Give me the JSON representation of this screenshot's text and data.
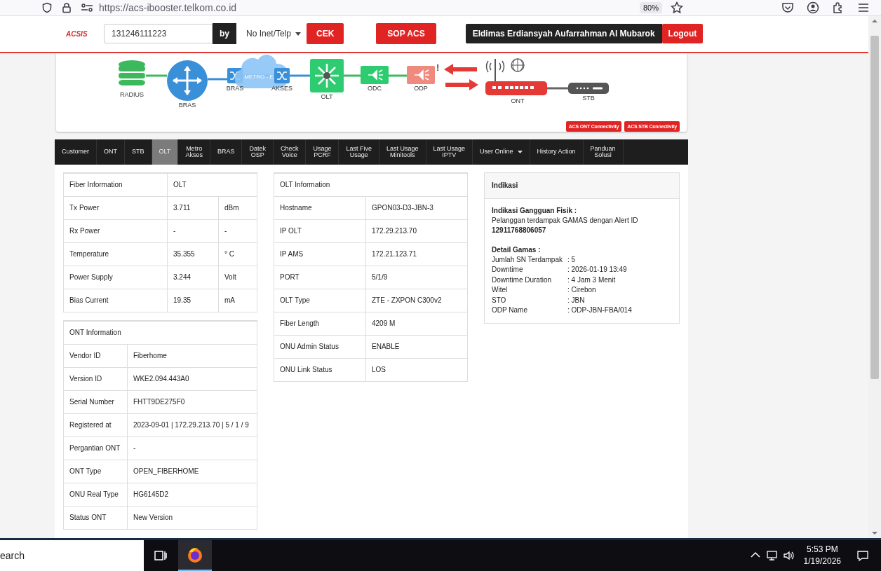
{
  "browser": {
    "url": "https://acs-ibooster.telkom.co.id",
    "zoom": "80%"
  },
  "header": {
    "logo": "ACSIS",
    "search_value": "131246111223",
    "by": "by",
    "select": "No Inet/Telp",
    "cek": "CEK",
    "sop": "SOP ACS",
    "user": "Eldimas Erdiansyah Aufarrahman Al Mubarok",
    "logout": "Logout"
  },
  "diagram": {
    "cloud_label": "METRO - E",
    "alert_mark": "!",
    "nodes": [
      {
        "kind": "radius",
        "label": "RADIUS",
        "alert": false
      },
      {
        "kind": "router",
        "label": "BRAS",
        "alert": false
      },
      {
        "kind": "switch",
        "label": "BRAS",
        "alert": false
      },
      {
        "kind": "switch2",
        "label": "AKSES",
        "alert": false
      },
      {
        "kind": "olt",
        "label": "OLT",
        "alert": false
      },
      {
        "kind": "splitter",
        "label": "ODC",
        "alert": false
      },
      {
        "kind": "splitter2",
        "label": "ODP",
        "alert": true
      },
      {
        "kind": "ont",
        "label": "ONT",
        "alert": false
      },
      {
        "kind": "stb",
        "label": "STB",
        "alert": false
      }
    ],
    "buttons": [
      "ACS ONT Connectivity",
      "ACS STB Connectivity"
    ]
  },
  "tabs": [
    {
      "label": "Customer",
      "selected": false,
      "menu": false
    },
    {
      "label": "ONT",
      "selected": false,
      "menu": false
    },
    {
      "label": "STB",
      "selected": false,
      "menu": false
    },
    {
      "label": "OLT",
      "selected": true,
      "menu": false
    },
    {
      "label": "Metro\nAkses",
      "selected": false,
      "menu": false
    },
    {
      "label": "BRAS",
      "selected": false,
      "menu": false
    },
    {
      "label": "Datek\nOSP",
      "selected": false,
      "menu": false
    },
    {
      "label": "Check\nVoice",
      "selected": false,
      "menu": false
    },
    {
      "label": "Usage\nPCRF",
      "selected": false,
      "menu": false
    },
    {
      "label": "Last Five\nUsage",
      "selected": false,
      "menu": false
    },
    {
      "label": "Last Usage\nMinitools",
      "selected": false,
      "menu": false
    },
    {
      "label": "Last Usage\nIPTV",
      "selected": false,
      "menu": false
    },
    {
      "label": "User Online",
      "selected": false,
      "menu": true
    },
    {
      "label": "History Action",
      "selected": false,
      "menu": false
    },
    {
      "label": "Panduan\nSolusi",
      "selected": false,
      "menu": false
    }
  ],
  "fiber_information": {
    "columns": [
      "Fiber Information",
      "OLT"
    ],
    "rows": [
      [
        "Tx Power",
        "3.711",
        "dBm"
      ],
      [
        "Rx Power",
        "-",
        "-"
      ],
      [
        "Temperature",
        "35.355",
        "° C"
      ],
      [
        "Power Supply",
        "3.244",
        "Volt"
      ],
      [
        "Bias Current",
        "19.35",
        "mA"
      ]
    ]
  },
  "ont_information": {
    "title": "ONT Information",
    "rows": [
      [
        "Vendor ID",
        "Fiberhome"
      ],
      [
        "Version ID",
        "WKE2.094.443A0"
      ],
      [
        "Serial Number",
        "FHTT9DE275F0"
      ],
      [
        "Registered at",
        "2023-09-01 | 172.29.213.70 | 5 / 1 / 9"
      ],
      [
        "Pergantian ONT",
        "-"
      ],
      [
        "ONT Type",
        "OPEN_FIBERHOME"
      ],
      [
        "ONU Real Type",
        "HG6145D2"
      ],
      [
        "Status ONT",
        "New Version"
      ]
    ]
  },
  "olt_information": {
    "title": "OLT Information",
    "rows": [
      [
        "Hostname",
        "GPON03-D3-JBN-3"
      ],
      [
        "IP OLT",
        "172.29.213.70"
      ],
      [
        "IP AMS",
        "172.21.123.71"
      ],
      [
        "PORT",
        "5/1/9"
      ],
      [
        "OLT Type",
        "ZTE - ZXPON C300v2"
      ],
      [
        "Fiber Length",
        "4209 M"
      ],
      [
        "ONU Admin Status",
        "ENABLE"
      ],
      [
        "ONU Link Status",
        "LOS"
      ]
    ]
  },
  "indikasi": {
    "title": "Indikasi",
    "heading": "Indikasi Gangguan Fisik :",
    "message": "Pelanggan terdampak GAMAS dengan Alert ID",
    "alert_id": "12911768806057",
    "detail_heading": "Detail Gamas :",
    "details": [
      {
        "label": "Jumlah SN Terdampak",
        "value": ": 5"
      },
      {
        "label": "Downtime",
        "value": ": 2026-01-19 13:49"
      },
      {
        "label": "Downtime Duration",
        "value": ": 4 Jam 3 Menit"
      },
      {
        "label": "Witel",
        "value": ": Cirebon"
      },
      {
        "label": "STO",
        "value": ": JBN"
      },
      {
        "label": "ODP Name",
        "value": ": ODP-JBN-FBA/014"
      }
    ]
  },
  "taskbar": {
    "search": "earch",
    "time": "5:53 PM",
    "date": "1/19/2026"
  }
}
